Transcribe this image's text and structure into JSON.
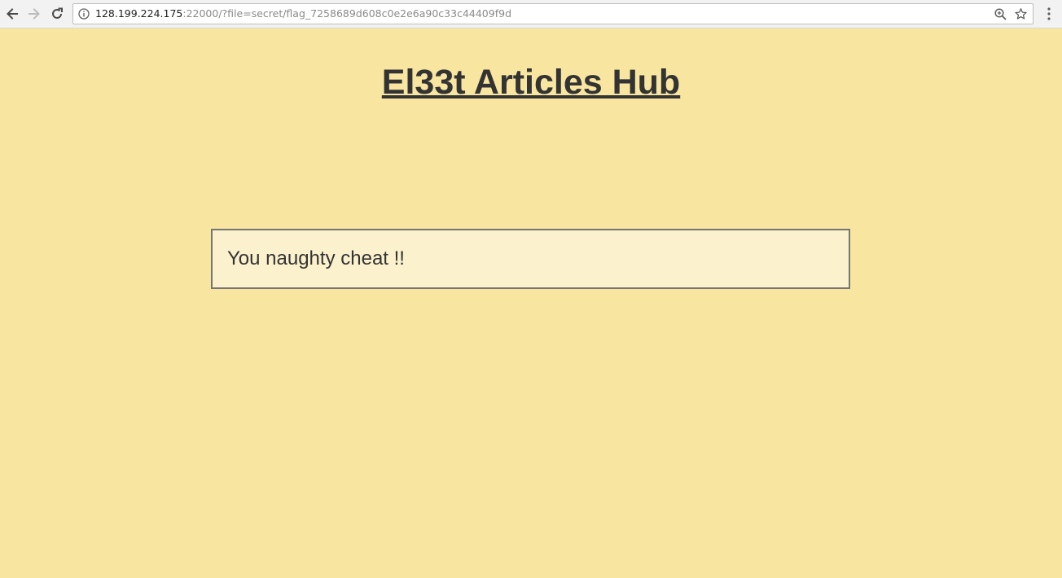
{
  "browser": {
    "url_host": "128.199.224.175",
    "url_rest": ":22000/?file=secret/flag_7258689d608c0e2e6a90c33c44409f9d",
    "icons": {
      "back": "arrow-left-icon",
      "forward": "arrow-right-icon",
      "reload": "reload-icon",
      "info": "info-icon",
      "zoom": "zoom-in-icon",
      "bookmark": "star-icon",
      "menu": "kebab-menu-icon"
    }
  },
  "page": {
    "title": "El33t Articles Hub",
    "message": "You naughty cheat !!"
  },
  "colors": {
    "background": "#f8e6a0",
    "message_box_background": "#fbf1cd",
    "text": "#333333",
    "box_border": "#757575"
  }
}
